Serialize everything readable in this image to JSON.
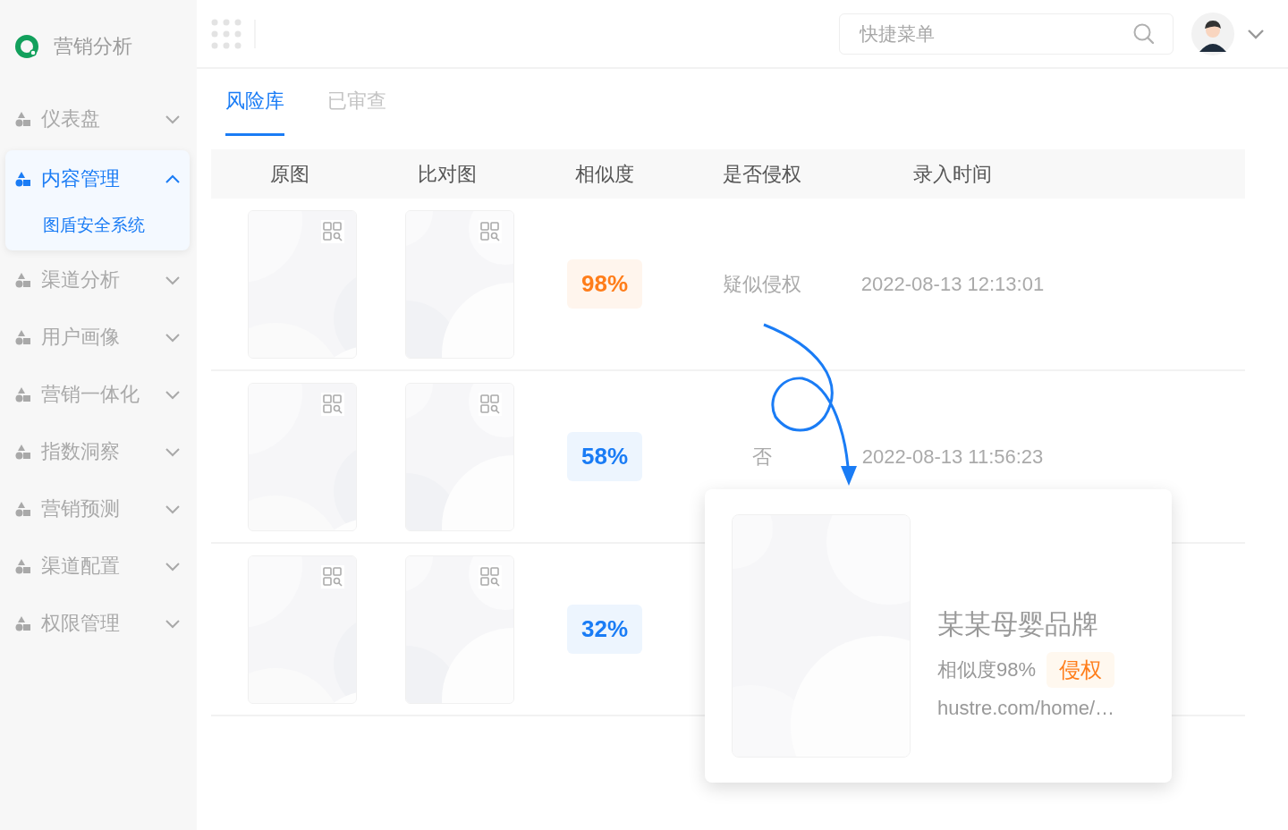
{
  "brand": {
    "name": "营销分析"
  },
  "sidebar": {
    "items": [
      {
        "label": "仪表盘",
        "expanded": false,
        "selected": false
      },
      {
        "label": "内容管理",
        "expanded": true,
        "selected": true,
        "children": [
          {
            "label": "图盾安全系统",
            "selected": true
          }
        ]
      },
      {
        "label": "渠道分析",
        "expanded": false,
        "selected": false
      },
      {
        "label": "用户画像",
        "expanded": false,
        "selected": false
      },
      {
        "label": "营销一体化",
        "expanded": false,
        "selected": false
      },
      {
        "label": "指数洞察",
        "expanded": false,
        "selected": false
      },
      {
        "label": "营销预测",
        "expanded": false,
        "selected": false
      },
      {
        "label": "渠道配置",
        "expanded": false,
        "selected": false
      },
      {
        "label": "权限管理",
        "expanded": false,
        "selected": false
      }
    ]
  },
  "header": {
    "search": {
      "placeholder": "快捷菜单"
    }
  },
  "tabs": [
    {
      "label": "风险库",
      "selected": true
    },
    {
      "label": "已审查",
      "selected": false
    }
  ],
  "table": {
    "columns": [
      "原图",
      "比对图",
      "相似度",
      "是否侵权",
      "录入时间"
    ],
    "rows": [
      {
        "similarity": "98%",
        "color": "#ff7d1a",
        "infringement": "疑似侵权",
        "time": "2022-08-13 12:13:01"
      },
      {
        "similarity": "58%",
        "color": "#1a7cf5",
        "infringement": "否",
        "time": "2022-08-13 11:56:23"
      },
      {
        "similarity": "32%",
        "color": "#1a7cf5"
      }
    ]
  },
  "popup": {
    "title": "某某母婴品牌",
    "similarity": "相似度98%",
    "tag": "侵权",
    "url": "hustre.com/home/…"
  }
}
